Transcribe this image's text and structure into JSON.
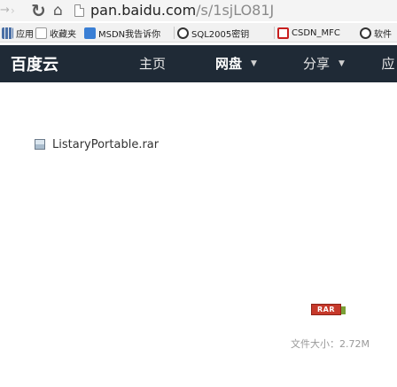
{
  "browser": {
    "url_host": "pan.baidu.com",
    "url_path": "/s/1sjLO81J",
    "bookmarks": [
      {
        "label": "应用",
        "icon": "apps-icon",
        "color": "#4a6fa5"
      },
      {
        "label": "收藏夹",
        "icon": "folder-icon",
        "color": "#e0b040"
      },
      {
        "label": "MSDN我告诉你",
        "icon": "msdn-icon",
        "color": "#3a7fd5"
      },
      {
        "label": "SQL2005密钥",
        "icon": "sql-icon",
        "color": "#333333"
      },
      {
        "label": "CSDN_MFC",
        "icon": "csdn-icon",
        "color": "#c81e1e"
      },
      {
        "label": "软件",
        "icon": "software-icon",
        "color": "#333333"
      }
    ]
  },
  "nav": {
    "logo": "百度云",
    "items": [
      {
        "label": "主页"
      },
      {
        "label": "网盘"
      },
      {
        "label": "分享"
      },
      {
        "label": "应"
      }
    ],
    "colors": {
      "bar": "#1f2a36"
    }
  },
  "file": {
    "name": "ListaryPortable.rar",
    "type_label": "RAR",
    "size_label": "文件大小：2.72M"
  }
}
